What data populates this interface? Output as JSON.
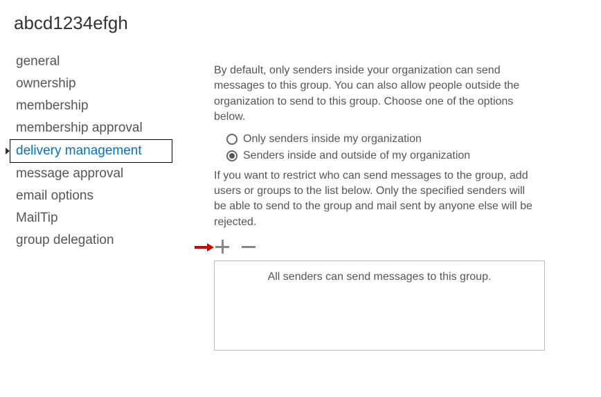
{
  "title": "abcd1234efgh",
  "sidebar": {
    "items": [
      {
        "label": "general"
      },
      {
        "label": "ownership"
      },
      {
        "label": "membership"
      },
      {
        "label": "membership approval"
      },
      {
        "label": "delivery management"
      },
      {
        "label": "message approval"
      },
      {
        "label": "email options"
      },
      {
        "label": "MailTip"
      },
      {
        "label": "group delegation"
      }
    ],
    "selected_index": 4
  },
  "content": {
    "intro": "By default, only senders inside your organization can send messages to this group. You can also allow people outside the organization to send to this group. Choose one of the options below.",
    "radios": [
      {
        "label": "Only senders inside my organization",
        "selected": false
      },
      {
        "label": "Senders inside and outside of my organization",
        "selected": true
      }
    ],
    "restrict_text": "If you want to restrict who can send messages to the group, add users or groups to the list below. Only the specified senders will be able to send to the group and mail sent by anyone else will be rejected.",
    "senders_placeholder": "All senders can send messages to this group."
  }
}
